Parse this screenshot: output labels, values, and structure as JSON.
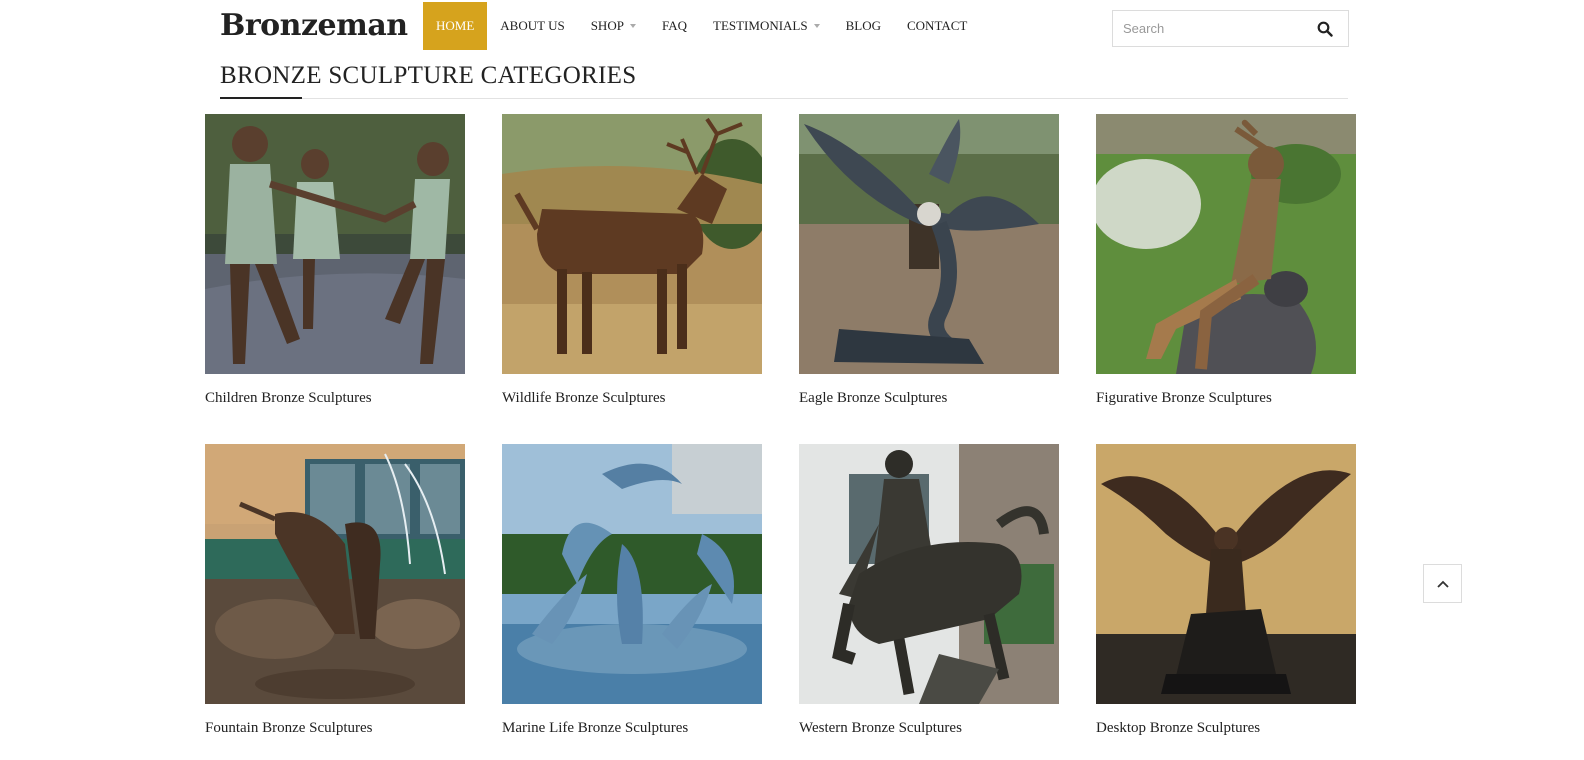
{
  "brand": "Bronzeman",
  "nav": [
    {
      "label": "HOME",
      "active": true
    },
    {
      "label": "ABOUT US"
    },
    {
      "label": "SHOP",
      "dropdown": true
    },
    {
      "label": "FAQ"
    },
    {
      "label": "TESTIMONIALS",
      "dropdown": true
    },
    {
      "label": "BLOG"
    },
    {
      "label": "CONTACT"
    }
  ],
  "search": {
    "placeholder": "Search"
  },
  "accent_color": "#d6a31d",
  "section_title": "BRONZE SCULPTURE CATEGORIES",
  "categories": [
    {
      "label": "Children Bronze Sculptures"
    },
    {
      "label": "Wildlife Bronze Sculptures"
    },
    {
      "label": "Eagle Bronze Sculptures"
    },
    {
      "label": "Figurative Bronze Sculptures"
    },
    {
      "label": "Fountain Bronze Sculptures"
    },
    {
      "label": "Marine Life Bronze Sculptures"
    },
    {
      "label": "Western Bronze Sculptures"
    },
    {
      "label": "Desktop Bronze Sculptures"
    }
  ]
}
